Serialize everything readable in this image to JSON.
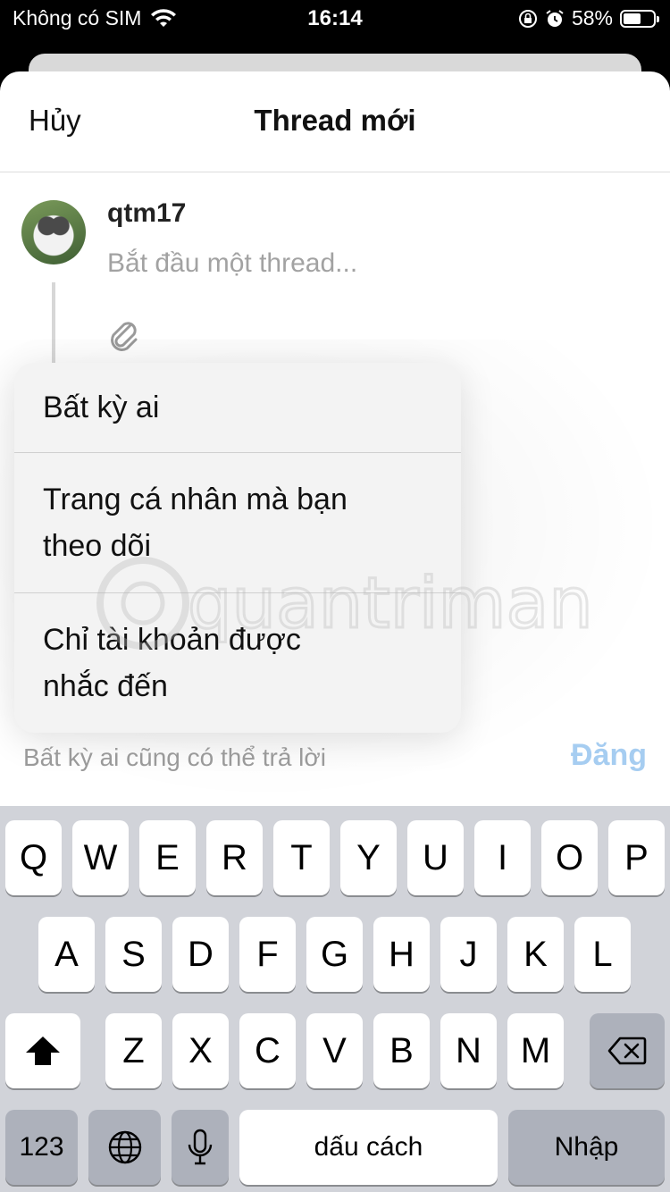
{
  "status_bar": {
    "carrier": "Không có SIM",
    "time": "16:14",
    "battery": "58%",
    "battery_level": 0.58
  },
  "header": {
    "cancel_label": "Hủy",
    "title": "Thread mới"
  },
  "composer": {
    "username": "qtm17",
    "placeholder": "Bắt đầu một thread..."
  },
  "reply_menu": {
    "items": [
      "Bất kỳ ai",
      "Trang cá nhân mà bạn\ntheo dõi",
      "Chỉ tài khoản được\nnhắc đến"
    ]
  },
  "footer": {
    "reply_hint": "Bất kỳ ai cũng có thể trả lời",
    "post_label": "Đăng"
  },
  "watermark": "quantrimang",
  "keyboard": {
    "row1": [
      "Q",
      "W",
      "E",
      "R",
      "T",
      "Y",
      "U",
      "I",
      "O",
      "P"
    ],
    "row2": [
      "A",
      "S",
      "D",
      "F",
      "G",
      "H",
      "J",
      "K",
      "L"
    ],
    "row3": [
      "Z",
      "X",
      "C",
      "V",
      "B",
      "N",
      "M"
    ],
    "numbers_label": "123",
    "space_label": "dấu cách",
    "return_label": "Nhập"
  },
  "colors": {
    "post_disabled": "#a6cdf1",
    "keyboard_bg": "#d1d3d9"
  }
}
